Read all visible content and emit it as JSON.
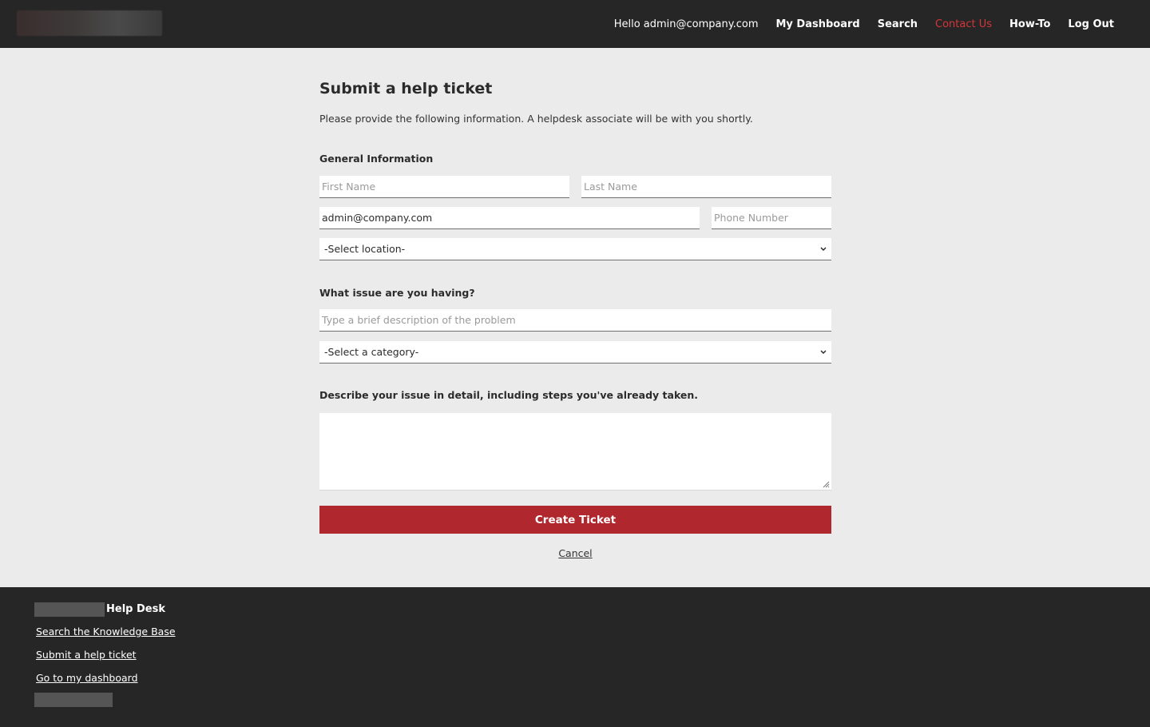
{
  "header": {
    "greeting": "Hello admin@company.com",
    "nav": [
      "My Dashboard",
      "Search",
      "Contact Us",
      "How-To",
      "Log Out"
    ],
    "active_color": "#d4363b"
  },
  "form": {
    "title": "Submit a help ticket",
    "intro": "Please provide the following information. A helpdesk associate will be with you shortly.",
    "general_label": "General Information",
    "first_name_placeholder": "First Name",
    "last_name_placeholder": "Last Name",
    "email_value": "admin@company.com",
    "phone_placeholder": "Phone Number",
    "location_select": "-Select location-",
    "issue_label": "What issue are you having?",
    "issue_placeholder": "Type a brief description of the problem",
    "category_select": "-Select a category-",
    "detail_label": "Describe your issue in detail, including steps you've already taken.",
    "submit_label": "Create Ticket",
    "cancel_label": "Cancel",
    "accent_color": "#b0282e"
  },
  "footer": {
    "title": "Help Desk",
    "links": [
      "Search the Knowledge Base",
      "Submit a help ticket",
      "Go to my dashboard"
    ]
  }
}
